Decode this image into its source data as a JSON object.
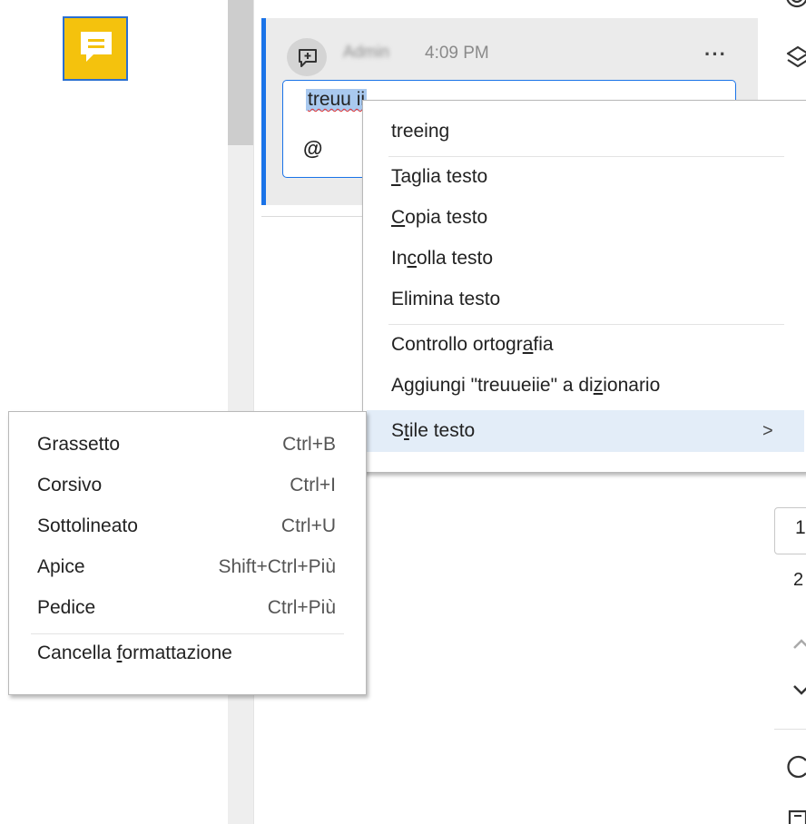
{
  "sticky_note": {
    "icon": "sticky-note-icon",
    "color": "#f4c20d"
  },
  "comment": {
    "author": "Admin",
    "time": "4:09 PM",
    "more_label": "···",
    "reply_text": "treuu ii",
    "mention_label": "@",
    "accent_color": "#1a73e8"
  },
  "context_menu": {
    "suggestion": "treeing",
    "cut": {
      "pre": "",
      "u": "T",
      "post": "aglia testo"
    },
    "copy": {
      "pre": "",
      "u": "C",
      "post": "opia testo"
    },
    "paste": {
      "pre": "In",
      "u": "c",
      "post": "olla testo"
    },
    "delete": "Elimina testo",
    "spellcheck": {
      "pre": "Controllo ortogr",
      "u": "a",
      "post": "fia"
    },
    "add_dictionary": {
      "pre": "Aggiungi \"treuueiie\" a di",
      "u": "z",
      "post": "ionario"
    },
    "text_style": {
      "pre": "S",
      "u": "t",
      "post": "ile testo"
    },
    "submenu_arrow": ">"
  },
  "format_menu": {
    "items": [
      {
        "label": "Grassetto",
        "shortcut": "Ctrl+B"
      },
      {
        "label": "Corsivo",
        "shortcut": "Ctrl+I"
      },
      {
        "label": "Sottolineato",
        "shortcut": "Ctrl+U"
      },
      {
        "label": "Apice",
        "shortcut": "Shift+Ctrl+Più"
      },
      {
        "label": "Pedice",
        "shortcut": "Ctrl+Più"
      }
    ],
    "clear": {
      "pre": "Cancella ",
      "u": "f",
      "post": "ormattazione"
    }
  },
  "right_panel": {
    "page_value": "1",
    "page_total": "2",
    "icons": [
      "target-icon",
      "layers-icon",
      "chevron-up-icon",
      "chevron-down-icon",
      "refresh-icon",
      "page-icon"
    ]
  }
}
